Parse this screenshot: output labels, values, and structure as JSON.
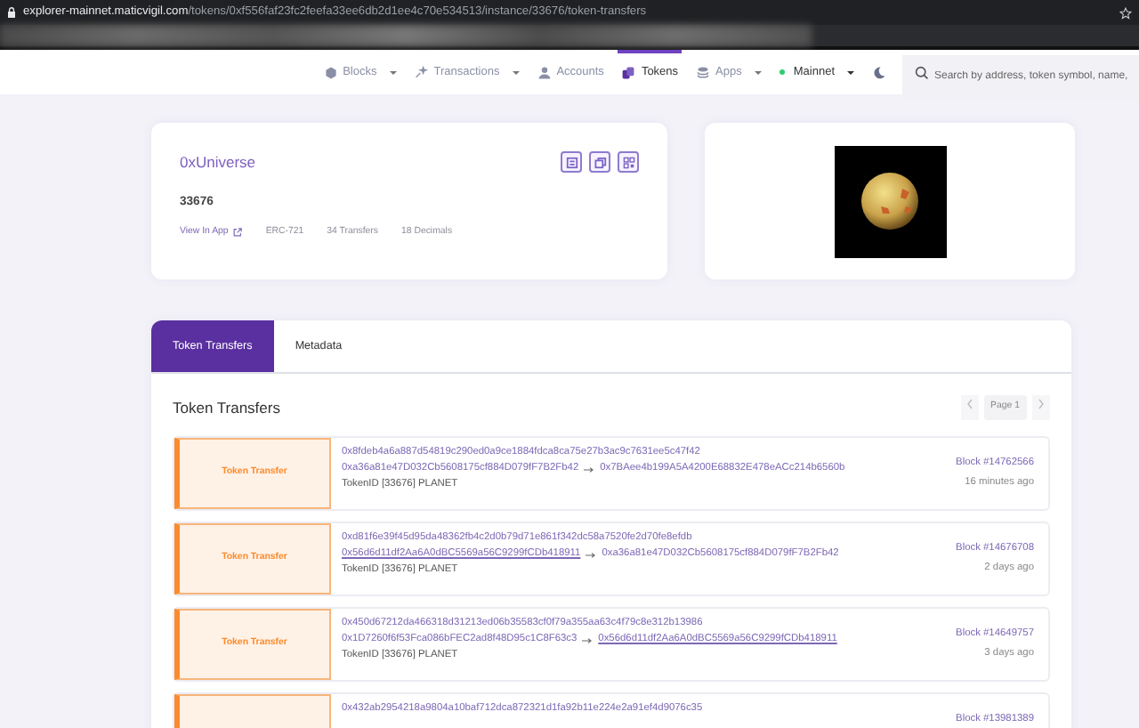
{
  "browser": {
    "url_host": "explorer-mainnet.maticvigil.com",
    "url_path": "/tokens/0xf556faf23fc2feefa33ee6db2d1ee4c70e534513/instance/33676/token-transfers"
  },
  "navbar": {
    "items": [
      {
        "kind": "blocks",
        "label": "Blocks",
        "dropdown": true,
        "selected": false
      },
      {
        "kind": "transactions",
        "label": "Transactions",
        "dropdown": true,
        "selected": false
      },
      {
        "kind": "accounts",
        "label": "Accounts",
        "dropdown": false,
        "selected": false
      },
      {
        "kind": "tokens",
        "label": "Tokens",
        "dropdown": false,
        "selected": true
      },
      {
        "kind": "apps",
        "label": "Apps",
        "dropdown": true,
        "selected": false
      }
    ],
    "network": "Mainnet",
    "search": {
      "placeholder": "Search by address, token symbol, name,"
    }
  },
  "token": {
    "name": "0xUniverse",
    "id": "33676",
    "view_link": "View In App",
    "standard": "ERC-721",
    "transfers": "34 Transfers",
    "decimals": "18 Decimals"
  },
  "tabs": [
    {
      "label": "Token Transfers",
      "selected": true
    },
    {
      "label": "Metadata",
      "selected": false
    }
  ],
  "transfers": {
    "title": "Token Transfers",
    "page": "Page 1",
    "items": [
      {
        "type": "Token Transfer",
        "hash": "0x8fdeb4a6a887d54819c290ed0a9ce1884fdca8ca75e27b3ac9c7631ee5c47f42",
        "from": "0xa36a81e47D032Cb5608175cf884D079fF7B2Fb42",
        "from_link": false,
        "to": "0x7BAee4b199A5A4200E68832E478eACc214b6560b",
        "to_link": false,
        "token": "TokenID [33676] PLANET",
        "block": "Block #14762566",
        "time": "16 minutes ago"
      },
      {
        "type": "Token Transfer",
        "hash": "0xd81f6e39f45d95da48362fb4c2d0b79d71e861f342dc58a7520fe2d70fe8efdb",
        "from": "0x56d6d11df2Aa6A0dBC5569a56C9299fCDb418911",
        "from_link": true,
        "to": "0xa36a81e47D032Cb5608175cf884D079fF7B2Fb42",
        "to_link": false,
        "token": "TokenID [33676] PLANET",
        "block": "Block #14676708",
        "time": "2 days ago"
      },
      {
        "type": "Token Transfer",
        "hash": "0x450d67212da466318d31213ed06b35583cf0f79a355aa63c4f79c8e312b13986",
        "from": "0x1D7260f6f53Fca086bFEC2ad8f48D95c1C8F63c3",
        "from_link": false,
        "to": "0x56d6d11df2Aa6A0dBC5569a56C9299fCDb418911",
        "to_link": true,
        "token": "TokenID [33676] PLANET",
        "block": "Block #14649757",
        "time": "3 days ago"
      },
      {
        "hash": "0x432ab2954218a9804a10baf712dca872321d1fa92b11e224e2a91ef4d9076c35",
        "block": "Block #13981389"
      }
    ]
  }
}
